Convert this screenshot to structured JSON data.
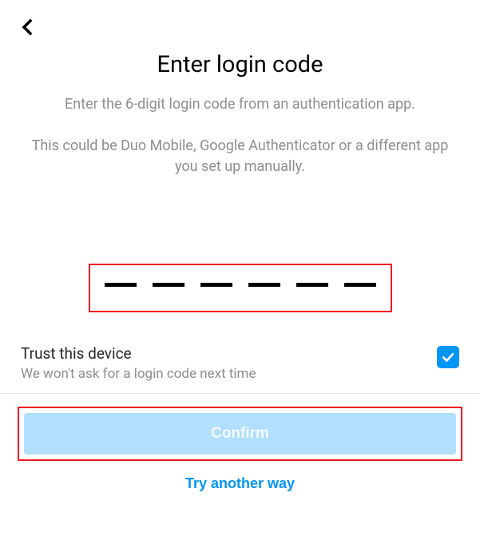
{
  "header": {
    "back_icon": "chevron-left"
  },
  "page": {
    "title": "Enter login code",
    "subtitle": "Enter the 6-digit login code from an authentication app.",
    "hint": "This could be Duo Mobile, Google Authenticator or a different app you set up manually."
  },
  "code_input": {
    "digit_count": 6,
    "value": ""
  },
  "trust": {
    "title": "Trust this device",
    "subtitle": "We won't ask for a login code next time",
    "checked": true
  },
  "actions": {
    "confirm_label": "Confirm",
    "confirm_enabled": false,
    "try_another_label": "Try another way"
  },
  "highlights": {
    "code_box": true,
    "confirm_box": true,
    "color": "#ed1c24"
  }
}
